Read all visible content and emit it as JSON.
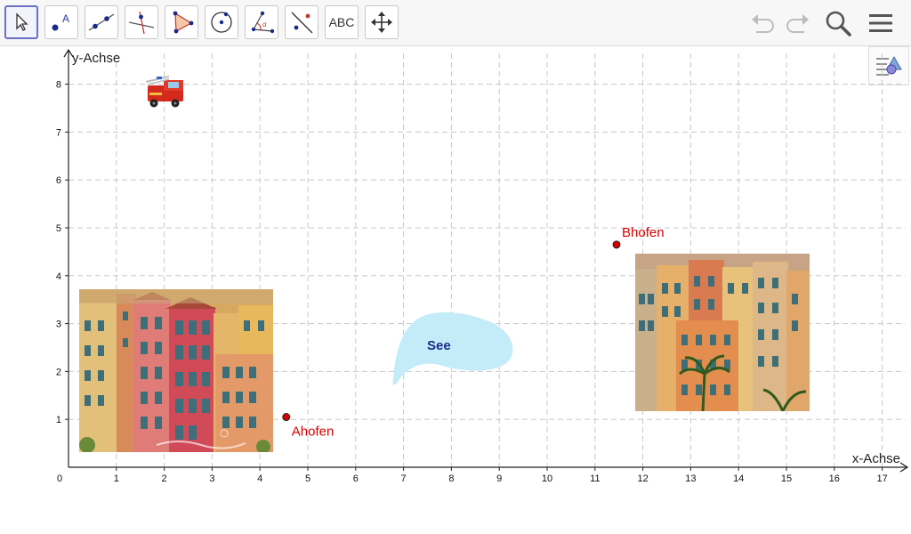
{
  "toolbar": {
    "tools": [
      {
        "name": "move-tool",
        "icon": "cursor-arrow-icon"
      },
      {
        "name": "point-tool",
        "icon": "point-icon"
      },
      {
        "name": "line-tool",
        "icon": "line-icon"
      },
      {
        "name": "perpendicular-tool",
        "icon": "perpendicular-line-icon"
      },
      {
        "name": "polygon-tool",
        "icon": "polygon-icon"
      },
      {
        "name": "circle-tool",
        "icon": "circle-icon"
      },
      {
        "name": "angle-tool",
        "icon": "angle-icon"
      },
      {
        "name": "reflect-tool",
        "icon": "reflect-icon"
      },
      {
        "name": "text-tool",
        "icon": "text-icon",
        "label": "ABC"
      },
      {
        "name": "move-graphics-view-tool",
        "icon": "move-arrows-icon"
      }
    ],
    "right": [
      "undo-icon",
      "redo-icon",
      "search-icon",
      "menu-icon"
    ]
  },
  "style_bar_icon": "style-bar-toggle-icon",
  "graph": {
    "xlabel": "x-Achse",
    "ylabel": "y-Achse",
    "x_ticks": [
      0,
      1,
      2,
      3,
      4,
      5,
      6,
      7,
      8,
      9,
      10,
      11,
      12,
      13,
      14,
      15,
      16,
      17
    ],
    "y_ticks": [
      1,
      2,
      3,
      4,
      5,
      6,
      7,
      8
    ],
    "grid": true,
    "points": [
      {
        "label": "Ahofen",
        "x": 4.55,
        "y": 1.05,
        "color": "#d40000"
      },
      {
        "label": "Bhofen",
        "x": 11.45,
        "y": 4.65,
        "color": "#d40000"
      }
    ],
    "lake_label": "See",
    "images": [
      {
        "name": "house-photo-left",
        "watermark": "dreamstime"
      },
      {
        "name": "house-photo-right"
      },
      {
        "name": "fire-truck-image"
      }
    ]
  }
}
